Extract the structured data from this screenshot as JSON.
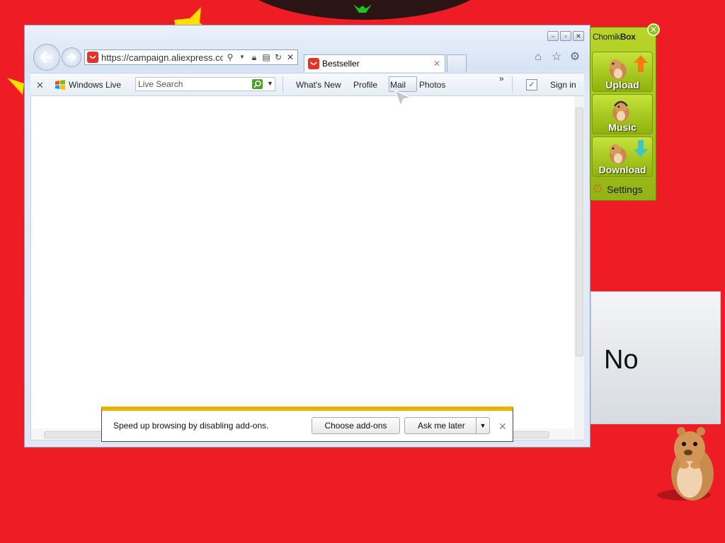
{
  "browser": {
    "address": "https://campaign.aliexpress.com",
    "tab_title": "Bestseller",
    "window_controls": [
      "minimize-icon",
      "maximize-icon",
      "close-icon"
    ],
    "toolbar_icons": [
      "home-icon",
      "star-icon",
      "gear-icon"
    ]
  },
  "command_bar": {
    "windows_live": "Windows Live",
    "search_placeholder": "Live Search",
    "items": [
      "What's New",
      "Profile",
      "Mail",
      "Photos"
    ],
    "sign_in": "Sign in",
    "more": "»"
  },
  "notification": {
    "message": "Speed up browsing by disabling add-ons.",
    "choose_label": "Choose add-ons",
    "ask_label": "Ask me later",
    "accent_color": "#f0b000"
  },
  "chomikbox": {
    "title_prefix": "Chomik",
    "title_suffix": "Box",
    "buttons": [
      "Upload",
      "Music",
      "Download"
    ],
    "settings": "Settings",
    "color": "#a4c41f"
  },
  "dialog": {
    "no_label": "No"
  },
  "colors": {
    "desktop": "#ee1c25"
  }
}
